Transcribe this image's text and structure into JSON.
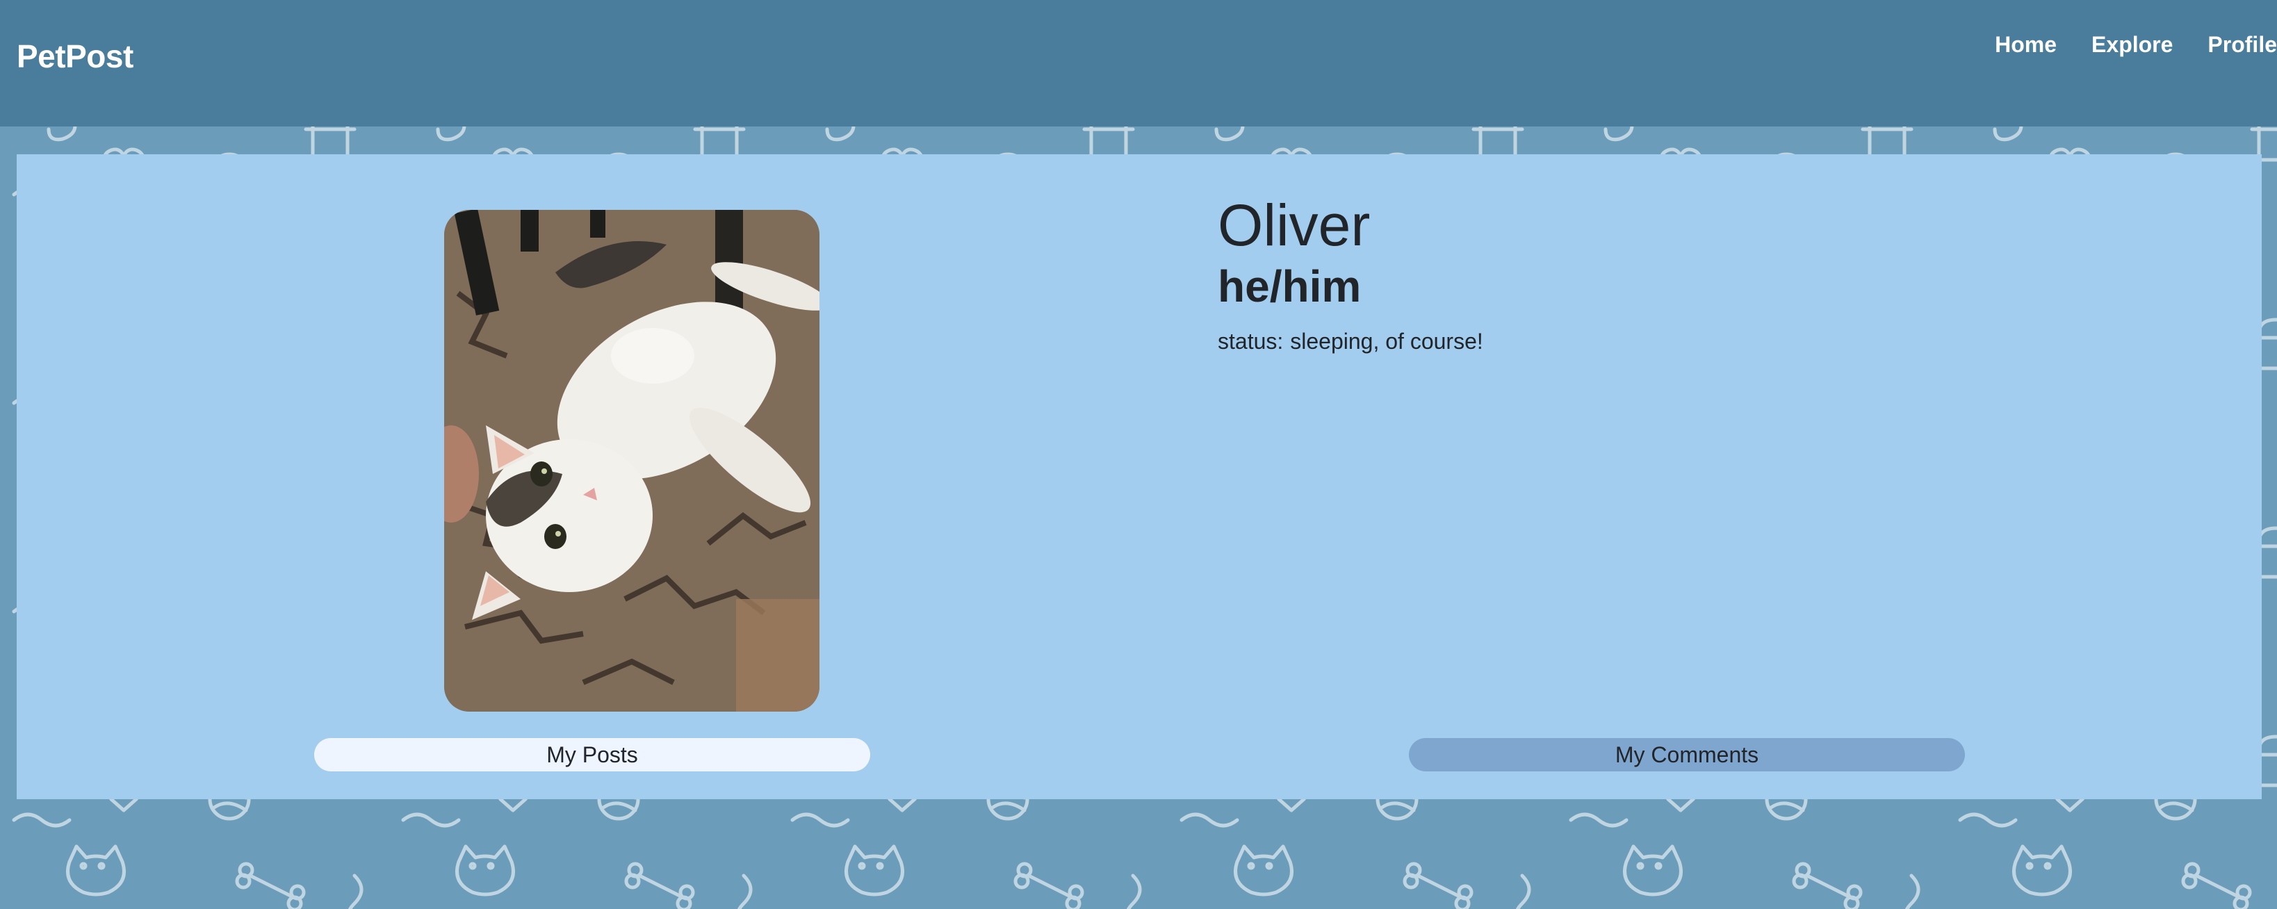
{
  "header": {
    "brand": "PetPost",
    "nav": [
      {
        "label": "Home"
      },
      {
        "label": "Explore"
      },
      {
        "label": "Profile"
      }
    ]
  },
  "profile": {
    "name": "Oliver",
    "pronouns": "he/him",
    "status_label": "status:",
    "status_text": "sleeping, of course!",
    "photo_alt": "Oliver"
  },
  "buttons": {
    "posts": "My Posts",
    "comments": "My Comments"
  },
  "colors": {
    "navbar": "#4a7d9c",
    "page_background": "#6b9dbb",
    "card": "#a2cdee",
    "posts_button": "#eff5ff",
    "comments_button": "#7fa6cf"
  }
}
